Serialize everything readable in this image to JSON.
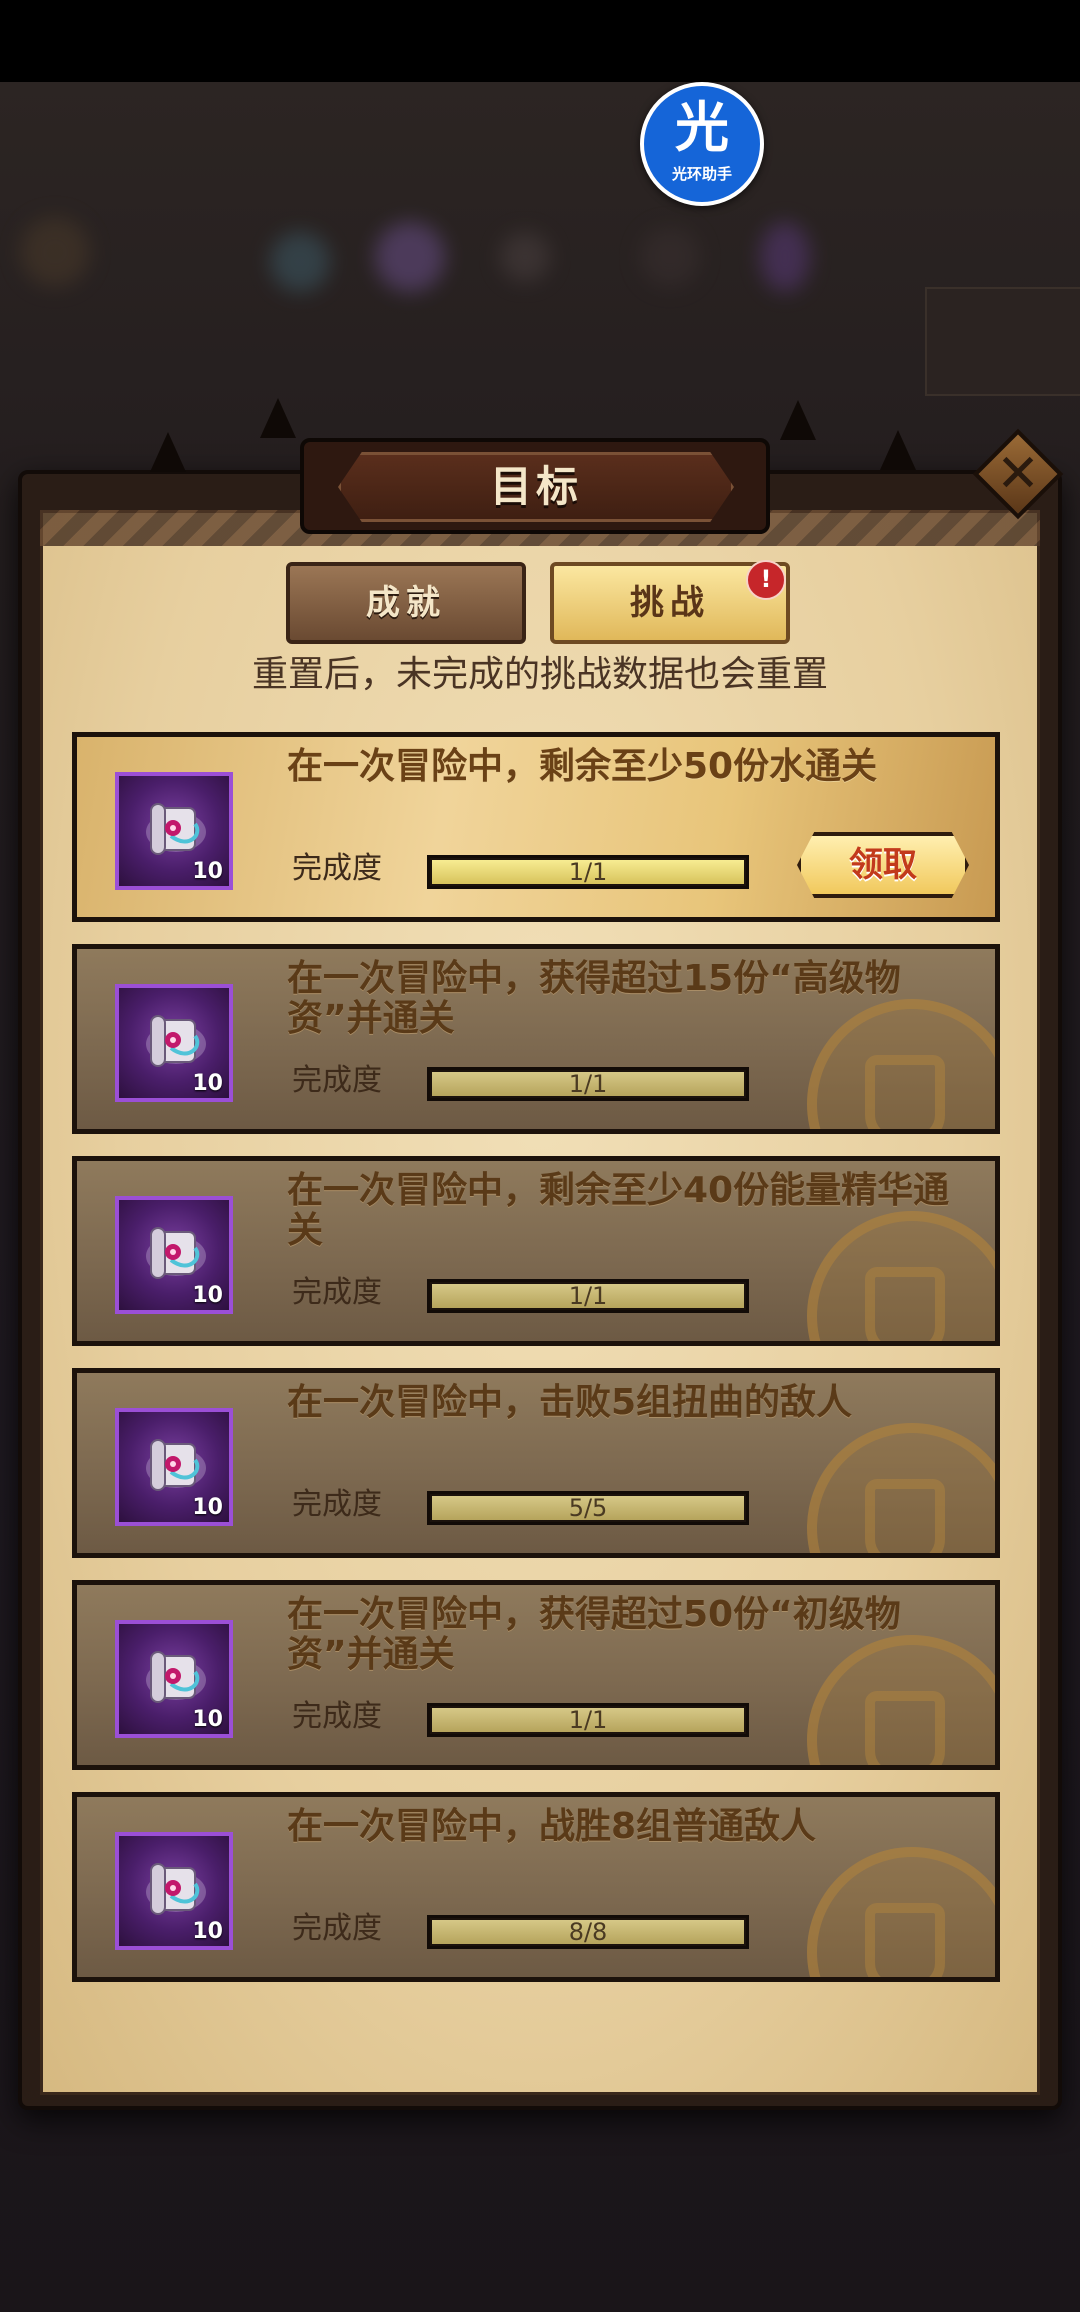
{
  "helper": {
    "glyph": "光",
    "label": "光环助手"
  },
  "header": {
    "title": "目标"
  },
  "tabs": [
    {
      "label": "成就",
      "active": false
    },
    {
      "label": "挑战",
      "active": true,
      "badge": "!"
    }
  ],
  "notice": "重置后，未完成的挑战数据也会重置",
  "challenges": [
    {
      "description": "在一次冒险中，剩余至少50份水通关",
      "progress_label": "完成度",
      "progress": "1/1",
      "progress_fraction": 1.0,
      "reward_count": "10",
      "claim_label": "领取",
      "claimable": true
    },
    {
      "description": "在一次冒险中，获得超过15份“高级物资”并通关",
      "progress_label": "完成度",
      "progress": "1/1",
      "progress_fraction": 1.0,
      "reward_count": "10",
      "claimable": false
    },
    {
      "description": "在一次冒险中，剩余至少40份能量精华通关",
      "progress_label": "完成度",
      "progress": "1/1",
      "progress_fraction": 1.0,
      "reward_count": "10",
      "claimable": false
    },
    {
      "description": "在一次冒险中，击败5组扭曲的敌人",
      "progress_label": "完成度",
      "progress": "5/5",
      "progress_fraction": 1.0,
      "reward_count": "10",
      "claimable": false
    },
    {
      "description": "在一次冒险中，获得超过50份“初级物资”并通关",
      "progress_label": "完成度",
      "progress": "1/1",
      "progress_fraction": 1.0,
      "reward_count": "10",
      "claimable": false
    },
    {
      "description": "在一次冒险中，战胜8组普通敌人",
      "progress_label": "完成度",
      "progress": "8/8",
      "progress_fraction": 1.0,
      "reward_count": "10",
      "claimable": false
    }
  ],
  "icons": {
    "close": "close-icon",
    "reward": "scroll-icon",
    "completed_seal": "seal-icon"
  },
  "colors": {
    "panel_parchment": "#e7cf9f",
    "goal_text": "#6a4116",
    "claim_text": "#c23a1c",
    "reward_slot": "#7a3fa0",
    "badge": "#c6262a"
  }
}
